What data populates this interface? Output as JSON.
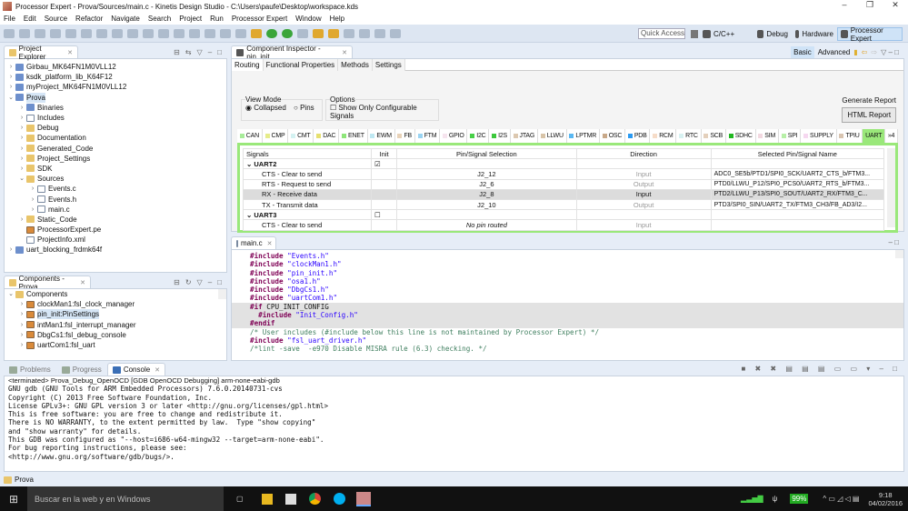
{
  "window": {
    "title": "Processor Expert - Prova/Sources/main.c - Kinetis Design Studio - C:\\Users\\paufe\\Desktop\\workspace.kds",
    "controls": [
      "–",
      "❐",
      "✕"
    ]
  },
  "menu": [
    "File",
    "Edit",
    "Source",
    "Refactor",
    "Navigate",
    "Search",
    "Project",
    "Run",
    "Processor Expert",
    "Window",
    "Help"
  ],
  "toolbar": {
    "quick_access": "Quick Access",
    "perspectives": [
      "C/C++",
      "Debug",
      "Hardware",
      "Processor Expert"
    ],
    "active_perspective": "Processor Expert"
  },
  "project_explorer": {
    "title": "Project Explorer",
    "items": [
      {
        "label": "Girbau_MK64FN1M0VLL12",
        "level": 0,
        "type": "project",
        "exp": ">"
      },
      {
        "label": "ksdk_platform_lib_K64F12",
        "level": 0,
        "type": "project",
        "exp": ">"
      },
      {
        "label": "myProject_MK64FN1M0VLL12",
        "level": 0,
        "type": "project",
        "exp": ">"
      },
      {
        "label": "Prova",
        "level": 0,
        "type": "project",
        "exp": "v",
        "selected": true
      },
      {
        "label": "Binaries",
        "level": 1,
        "type": "bin",
        "exp": ">"
      },
      {
        "label": "Includes",
        "level": 1,
        "type": "inc",
        "exp": ">"
      },
      {
        "label": "Debug",
        "level": 1,
        "type": "folder",
        "exp": ">"
      },
      {
        "label": "Documentation",
        "level": 1,
        "type": "folder",
        "exp": ">"
      },
      {
        "label": "Generated_Code",
        "level": 1,
        "type": "folder",
        "exp": ">"
      },
      {
        "label": "Project_Settings",
        "level": 1,
        "type": "folder",
        "exp": ">"
      },
      {
        "label": "SDK",
        "level": 1,
        "type": "folder",
        "exp": ">"
      },
      {
        "label": "Sources",
        "level": 1,
        "type": "folder",
        "exp": "v"
      },
      {
        "label": "Events.c",
        "level": 2,
        "type": "file",
        "exp": ">"
      },
      {
        "label": "Events.h",
        "level": 2,
        "type": "file",
        "exp": ">"
      },
      {
        "label": "main.c",
        "level": 2,
        "type": "file",
        "exp": ">"
      },
      {
        "label": "Static_Code",
        "level": 1,
        "type": "folder",
        "exp": ">"
      },
      {
        "label": "ProcessorExpert.pe",
        "level": 1,
        "type": "pe",
        "exp": ""
      },
      {
        "label": "ProjectInfo.xml",
        "level": 1,
        "type": "file",
        "exp": ""
      },
      {
        "label": "uart_blocking_frdmk64f",
        "level": 0,
        "type": "project",
        "exp": ">"
      }
    ]
  },
  "components": {
    "title": "Components - Prova",
    "items": [
      {
        "label": "Components",
        "level": 0,
        "exp": "v",
        "type": "folder"
      },
      {
        "label": "clockMan1:fsl_clock_manager",
        "level": 1,
        "exp": ">",
        "type": "comp"
      },
      {
        "label": "pin_init:PinSettings",
        "level": 1,
        "exp": ">",
        "type": "comp",
        "selected": true
      },
      {
        "label": "intMan1:fsl_interrupt_manager",
        "level": 1,
        "exp": ">",
        "type": "comp"
      },
      {
        "label": "DbgCs1:fsl_debug_console",
        "level": 1,
        "exp": ">",
        "type": "comp"
      },
      {
        "label": "uartCom1:fsl_uart",
        "level": 1,
        "exp": ">",
        "type": "comp"
      }
    ]
  },
  "inspector": {
    "title": "Component Inspector - pin_init",
    "modes": [
      "Basic",
      "Advanced"
    ],
    "active_mode": "Basic",
    "tabs": [
      "Routing",
      "Functional Properties",
      "Methods",
      "Settings"
    ],
    "active_tab": "Routing",
    "view_mode": {
      "label": "View Mode",
      "options": [
        "Collapsed",
        "Pins"
      ],
      "selected": "Collapsed"
    },
    "options": {
      "label": "Options",
      "checkbox": "Show Only Configurable Signals",
      "checked": false
    },
    "report": {
      "label": "Generate Report",
      "button": "HTML Report"
    },
    "periph_tabs": [
      {
        "l": "CAN",
        "c": "#a8ec9a"
      },
      {
        "l": "CMP",
        "c": "#e6ec8a"
      },
      {
        "l": "CMT",
        "c": "#d4f2f2"
      },
      {
        "l": "DAC",
        "c": "#e6e070"
      },
      {
        "l": "ENET",
        "c": "#8ee67a"
      },
      {
        "l": "EWM",
        "c": "#bfe8f2"
      },
      {
        "l": "FB",
        "c": "#e8d2b8"
      },
      {
        "l": "FTM",
        "c": "#9ad4f2"
      },
      {
        "l": "GPIO",
        "c": "#f6e4ee"
      },
      {
        "l": "I2C",
        "c": "#48d048"
      },
      {
        "l": "I2S",
        "c": "#3cc83c"
      },
      {
        "l": "JTAG",
        "c": "#dcc8b0"
      },
      {
        "l": "LLWU",
        "c": "#d8c4a8"
      },
      {
        "l": "LPTMR",
        "c": "#5ab8f2"
      },
      {
        "l": "OSC",
        "c": "#c8a888"
      },
      {
        "l": "PDB",
        "c": "#2a9af2"
      },
      {
        "l": "RCM",
        "c": "#f6dcc8"
      },
      {
        "l": "RTC",
        "c": "#d8f2f2"
      },
      {
        "l": "SCB",
        "c": "#e4d0bc"
      },
      {
        "l": "SDHC",
        "c": "#22b822"
      },
      {
        "l": "SIM",
        "c": "#f2d8e0"
      },
      {
        "l": "SPI",
        "c": "#b8f0a8"
      },
      {
        "l": "SUPPLY",
        "c": "#f6d8f0"
      },
      {
        "l": "TPIU",
        "c": "#d8c4b0"
      },
      {
        "l": "UART",
        "c": "#9ae87a"
      }
    ],
    "active_periph": "UART",
    "more": "»4",
    "columns": [
      "Signals",
      "Init",
      "Pin/Signal Selection",
      "Direction",
      "Selected Pin/Signal Name"
    ],
    "rows": [
      {
        "signal": "UART2",
        "group": true,
        "init": true
      },
      {
        "signal": "CTS - Clear to send",
        "pin": "J2_12",
        "dir": "Input",
        "name": "ADC0_SE5b/PTD1/SPI0_SCK/UART2_CTS_b/FTM3..."
      },
      {
        "signal": "RTS - Request to send",
        "pin": "J2_6",
        "dir": "Output",
        "name": "PTD0/LLWU_P12/SPI0_PCS0/UART2_RTS_b/FTM3..."
      },
      {
        "signal": "RX - Receive data",
        "pin": "J2_8",
        "dir": "Input",
        "name": "PTD2/LLWU_P13/SPI0_SOUT/UART2_RX/FTM3_C...",
        "selected": true
      },
      {
        "signal": "TX - Transmit data",
        "pin": "J2_10",
        "dir": "Output",
        "name": "PTD3/SPI0_SIN/UART2_TX/FTM3_CH3/FB_AD3/I2..."
      },
      {
        "signal": "UART3",
        "group": true,
        "init": false
      },
      {
        "signal": "CTS - Clear to send",
        "pin": "No pin routed",
        "dir": "Input",
        "name": "",
        "nopin": true
      }
    ]
  },
  "editor": {
    "tab": "main.c",
    "lines": [
      [
        [
          "kw",
          "#include "
        ],
        [
          "st",
          "\"Events.h\""
        ]
      ],
      [
        [
          "kw",
          "#include "
        ],
        [
          "st",
          "\"clockMan1.h\""
        ]
      ],
      [
        [
          "kw",
          "#include "
        ],
        [
          "st",
          "\"pin_init.h\""
        ]
      ],
      [
        [
          "kw",
          "#include "
        ],
        [
          "st",
          "\"osa1.h\""
        ]
      ],
      [
        [
          "kw",
          "#include "
        ],
        [
          "st",
          "\"DbgCs1.h\""
        ]
      ],
      [
        [
          "kw",
          "#include "
        ],
        [
          "st",
          "\"uartCom1.h\""
        ]
      ],
      [
        [
          "kw",
          "#if "
        ],
        [
          "",
          "CPU_INIT_CONFIG"
        ]
      ],
      [
        [
          "kw",
          "  #include "
        ],
        [
          "st",
          "\"Init_Config.h\""
        ]
      ],
      [
        [
          "kw",
          "#endif"
        ]
      ],
      [
        [
          "cm",
          "/* User includes (#include below this line is not maintained by Processor Expert) */"
        ]
      ],
      [
        [
          "kw",
          "#include "
        ],
        [
          "st",
          "\"fsl_uart_driver.h\""
        ]
      ],
      [
        [
          "cm",
          "/*lint -save  -e970 Disable MISRA rule (6.3) checking. */"
        ]
      ]
    ]
  },
  "console": {
    "tabs": [
      "Problems",
      "Progress",
      "Console"
    ],
    "active_tab": "Console",
    "header": "<terminated> Prova_Debug_OpenOCD [GDB OpenOCD Debugging] arm-none-eabi-gdb",
    "lines": [
      "GNU gdb (GNU Tools for ARM Embedded Processors) 7.6.0.20140731-cvs",
      "Copyright (C) 2013 Free Software Foundation, Inc.",
      "License GPLv3+: GNU GPL version 3 or later <http://gnu.org/licenses/gpl.html>",
      "This is free software: you are free to change and redistribute it.",
      "There is NO WARRANTY, to the extent permitted by law.  Type \"show copying\"",
      "and \"show warranty\" for details.",
      "This GDB was configured as \"--host=i686-w64-mingw32 --target=arm-none-eabi\".",
      "For bug reporting instructions, please see:",
      "<http://www.gnu.org/software/gdb/bugs/>."
    ]
  },
  "statusbar": {
    "text": "Prova"
  },
  "taskbar": {
    "search": "Buscar en la web y en Windows",
    "battery": "99%",
    "time": "9:18",
    "date": "04/02/2016"
  }
}
